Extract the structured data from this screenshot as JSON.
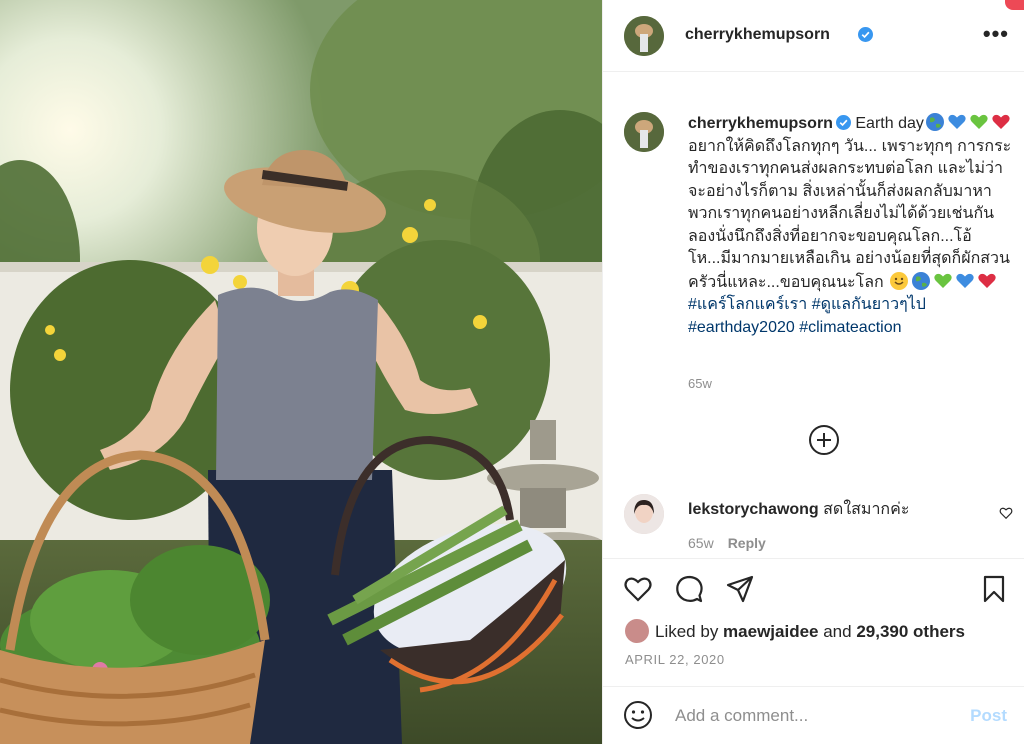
{
  "post": {
    "username": "cherrykhemupsorn",
    "more_icon": "more-options-icon"
  },
  "caption": {
    "username": "cherrykhemupsorn",
    "text_a": " Earth day",
    "text_b": " อยากให้คิดถึงโลกทุกๆ วัน... เพราะทุกๆ การกระทำของเราทุกคนส่งผลกระทบต่อโลก และไม่ว่าจะอย่างไรก็ตาม สิ่งเหล่านั้นก็ส่งผลกลับมาหาพวกเราทุกคนอย่างหลีกเลี่ยงไม่ได้ด้วยเช่นกัน ลองนั่งนึกถึงสิ่งที่อยากจะขอบคุณโลก...โอ้โห...มีมากมายเหลือเกิน อย่างน้อยที่สุดก็ผักสวนครัวนี่แหละ...ขอบคุณนะโลก ",
    "hashtags": [
      "#แคร์โลกแคร์เรา",
      "#ดูแลกันยาวๆไป",
      "#earthday2020",
      "#climateaction"
    ],
    "time": "65w"
  },
  "comment": {
    "username": "lekstorychawong",
    "text": "สดใสมากค่ะ",
    "time": "65w",
    "reply_label": "Reply"
  },
  "likes": {
    "prefix": "Liked by ",
    "user": "maewjaidee",
    "middle": " and ",
    "others": "29,390 others"
  },
  "date": "APRIL 22, 2020",
  "add_comment": {
    "placeholder": "Add a comment...",
    "post_label": "Post"
  },
  "colors": {
    "link": "#00376b",
    "verified": "#3897f0",
    "post_disabled": "#b3dbff",
    "secondary_text": "#8e8e8e"
  }
}
